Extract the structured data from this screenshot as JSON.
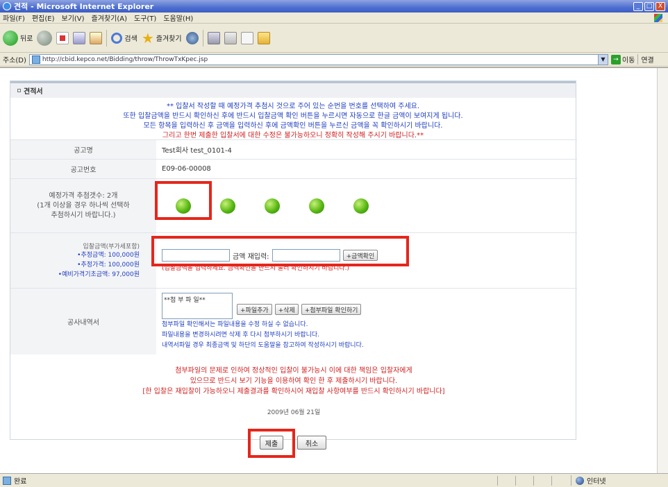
{
  "window": {
    "title": "견적 - Microsoft Internet Explorer",
    "controls": [
      "_",
      "□",
      "X"
    ]
  },
  "menubar": [
    "파일(F)",
    "편집(E)",
    "보기(V)",
    "즐겨찾기(A)",
    "도구(T)",
    "도움말(H)"
  ],
  "toolbar": {
    "back_label": "뒤로",
    "search_label": "검색",
    "favorites_label": "즐겨찾기"
  },
  "address": {
    "label": "주소(D)",
    "url": "http://cbid.kepco.net/Bidding/throw/ThrowTxKpec.jsp",
    "go_label": "이동",
    "links_label": "연결"
  },
  "panel": {
    "title": "견적서"
  },
  "notice": {
    "line1": "** 입찰서 작성할 때 예정가격 추첨시 것으로 주어 있는 순번을 번호를 선택하여 주세요.",
    "line2": "또한 입찰금액을 반드시 확인하신 후에 반드시 입찰금액 확인 버튼을 누르시면 자동으로 한글 금액이 보여지게 됩니다.",
    "line3": "모든 항목을 입력하신 후 금액을 입력하신 후에 금액확인 버튼을 누르신 금액을 꼭 확인하시기 바랍니다.",
    "line4": "그리고 한번 제출한 입찰서에 대한 수정은 불가능하오니 정확히 작성해 주시기 바랍니다.**"
  },
  "rows": {
    "notice_no_label": "공고명",
    "notice_no_value": "Test회사 test_0101-4",
    "bid_no_label": "공고번호",
    "bid_no_value": "E09-06-00008",
    "price_label_line1": "예정가격 추첨갯수: 2개",
    "price_label_line2": "(1개 이상을 경우 하나씩 선택하",
    "price_label_line3": "추첨하시기 바랍니다.)",
    "amount_label": "입찰금액(부가세포함)",
    "estimated_amount": "•추정금액:  100,000원",
    "estimated_price": "•추정가격:  100,000원",
    "base_price": "•예비가격기초금액:  97,000원",
    "amount_mid_label": "금액 재입력:",
    "amount_check_btn": "+금액확인",
    "amount_warn": "(입찰금액을 입력하세요. 금액확인을 반드시 눌러 확인하시기 바랍니다.)",
    "attach_label": "공사내역서",
    "attach_box_text": "**첨 부 파 일**",
    "add_file_btn": "+파일추가",
    "delete_btn": "+삭제",
    "check_file_btn": "+첨부파일 확인하기",
    "attach_desc1": "첨부파일 확인해서는 파일내용을 수정 하실 수 없습니다.",
    "attach_desc2": "파일내용을 변경하시려면 삭제 후 다시 첨부하시기 바랍니다.",
    "attach_desc3": "내역서파일 경우 최종금액 및 하단의 도움말을 참고하여 작성하시기 바랍니다."
  },
  "warning": {
    "line1": "첨부파일의 문제로 인하여 정상적인 입찰이 불가능시 이에 대한 책임은 입찰자에게",
    "line2": "있으므로 반드시 보기 기능을 이용하여 확인 한 후 제출하시기 바랍니다.",
    "line3": "[한 입찰은 재입찰이 가능하오니 제출결과를 확인하시어 재입찰 사항여부를 반드시 확인하시기 바랍니다]"
  },
  "date_text": "2009년 06월 21일",
  "buttons": {
    "submit": "제출",
    "cancel": "취소"
  },
  "status": {
    "text": "완료",
    "zone": "인터넷"
  },
  "price_item_count": 5,
  "colors": {
    "highlight": "#e5261b",
    "notice_blue": "#1f3fbf",
    "notice_red": "#d02020"
  }
}
